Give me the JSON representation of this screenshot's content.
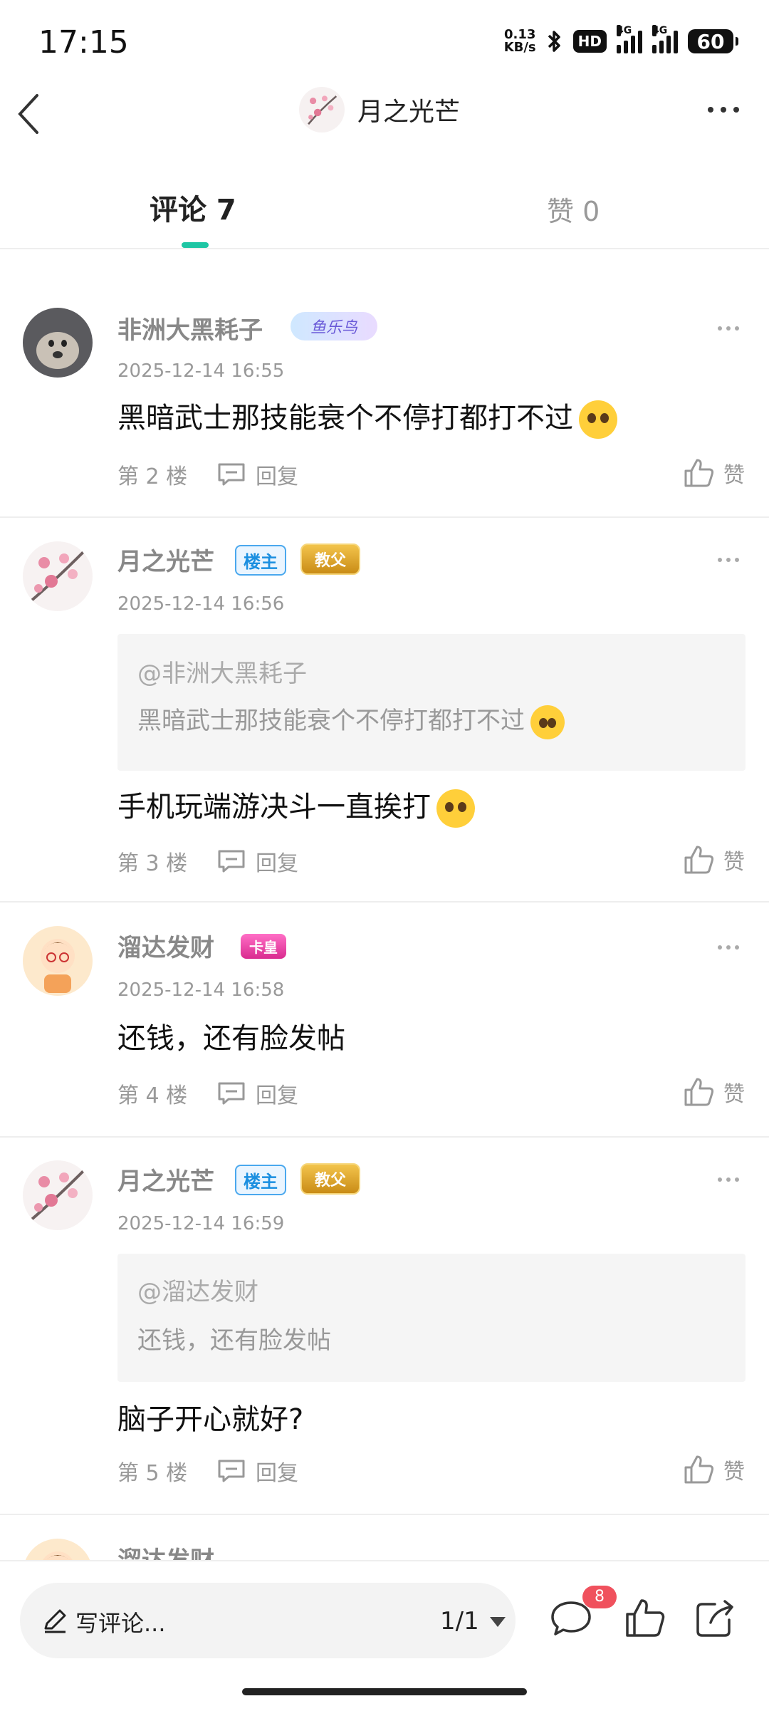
{
  "status_bar": {
    "time": "17:15",
    "net_speed_top": "0.13",
    "net_speed_bottom": "KB/s",
    "hd": "HD",
    "net1": "4G",
    "net2": "4G",
    "battery": "60"
  },
  "header": {
    "title": "月之光芒"
  },
  "tabs": {
    "comments": "评论 7",
    "likes": "赞 0"
  },
  "posts": [
    {
      "user": "非洲大黑耗子",
      "badge": "鱼乐鸟",
      "time": "2025-12-14 16:55",
      "content": "黑暗武士那技能衰个不停打都打不过",
      "floor": "第 2 楼",
      "reply": "回复",
      "like": "赞"
    },
    {
      "user": "月之光芒",
      "owner_badge": "楼主",
      "title_badge": "教父",
      "time": "2025-12-14 16:56",
      "quote_user": "@非洲大黑耗子",
      "quote_text": "黑暗武士那技能衰个不停打都打不过",
      "content": "手机玩端游决斗一直挨打",
      "floor": "第 3 楼",
      "reply": "回复",
      "like": "赞"
    },
    {
      "user": "溜达发财",
      "title_badge": "卡皇",
      "time": "2025-12-14 16:58",
      "content": "还钱，还有脸发帖",
      "floor": "第 4 楼",
      "reply": "回复",
      "like": "赞"
    },
    {
      "user": "月之光芒",
      "owner_badge": "楼主",
      "title_badge": "教父",
      "time": "2025-12-14 16:59",
      "quote_user": "@溜达发财",
      "quote_text": "还钱，还有脸发帖",
      "content": "脑子开心就好?",
      "floor": "第 5 楼",
      "reply": "回复",
      "like": "赞"
    },
    {
      "user": "溜达发财"
    }
  ],
  "bottom_bar": {
    "placeholder": "写评论...",
    "page": "1/1",
    "comment_count": "8"
  },
  "colors": {
    "accent": "#1ec6a4",
    "badge_red": "#f0515d",
    "owner_blue": "#1b8fe0"
  }
}
